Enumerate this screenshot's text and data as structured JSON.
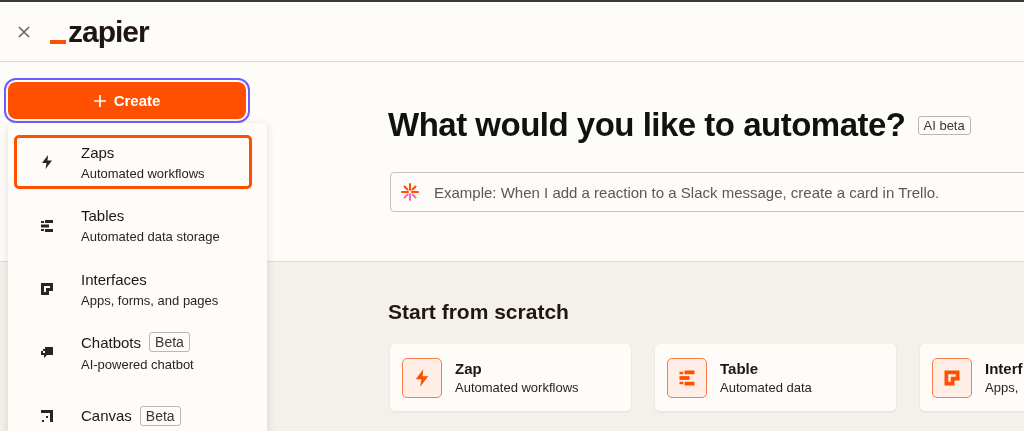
{
  "header": {
    "logo": "zapier"
  },
  "create_button": {
    "label": "Create"
  },
  "menu": {
    "items": [
      {
        "kind": "zaps",
        "title": "Zaps",
        "subtitle": "Automated workflows",
        "selected": true
      },
      {
        "kind": "tables",
        "title": "Tables",
        "subtitle": "Automated data storage",
        "selected": false
      },
      {
        "kind": "interfaces",
        "title": "Interfaces",
        "subtitle": "Apps, forms, and pages",
        "selected": false
      },
      {
        "kind": "chatbots",
        "title": "Chatbots",
        "badge": "Beta",
        "subtitle": "AI-powered chatbot",
        "selected": false
      },
      {
        "kind": "canvas",
        "title": "Canvas",
        "badge": "Beta",
        "selected": false
      }
    ]
  },
  "prompt": {
    "heading": "What would you like to automate?",
    "badge": "AI beta",
    "placeholder": "Example: When I add a reaction to a Slack message, create a card in Trello."
  },
  "scratch": {
    "heading": "Start from scratch",
    "cards": [
      {
        "kind": "zaps",
        "title": "Zap",
        "subtitle": "Automated workflows"
      },
      {
        "kind": "tables",
        "title": "Table",
        "subtitle": "Automated data"
      },
      {
        "kind": "interfaces",
        "title": "Interf",
        "subtitle": "Apps,"
      }
    ]
  }
}
